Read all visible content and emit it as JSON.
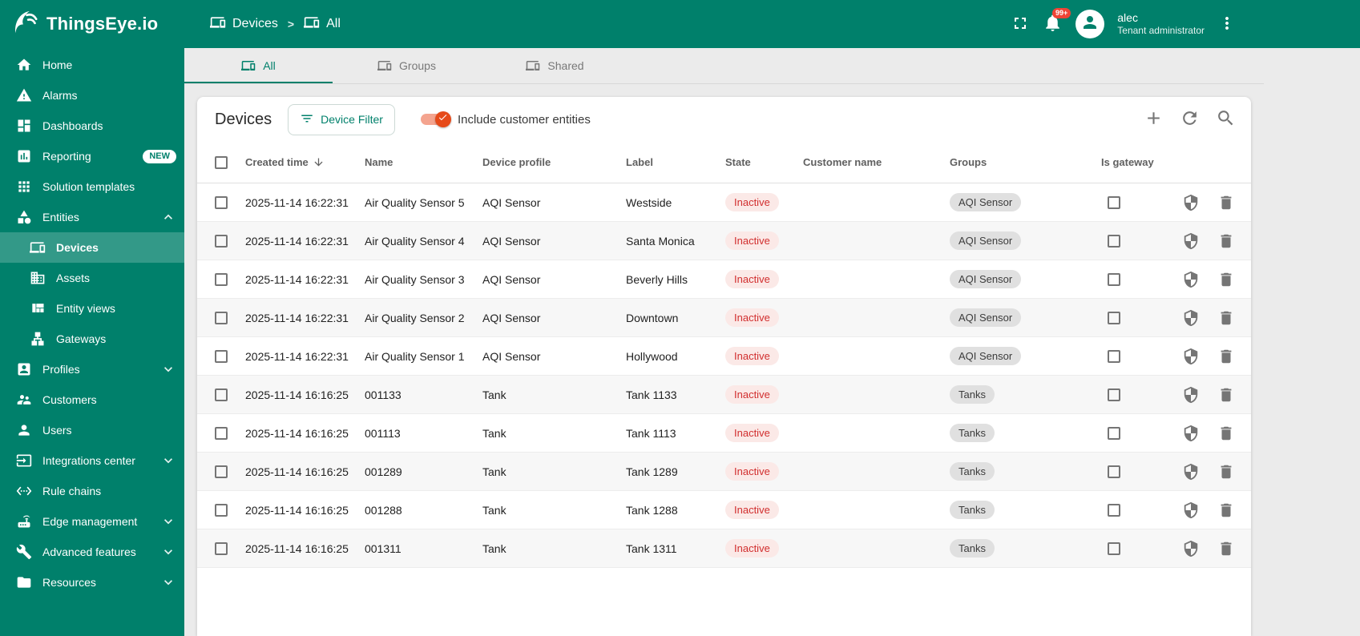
{
  "colors": {
    "brand_teal": "#00806b",
    "toggle_orange": "#e64a19",
    "toggle_track": "#f4a48f",
    "inactive_state_text": "#d12e2e",
    "inactive_state_bg": "#fbe9e7",
    "group_chip_bg": "#e0e0e0",
    "notification_badge_bg": "#ef4436"
  },
  "brand": {
    "name": "ThingsEye.io"
  },
  "header": {
    "breadcrumb": [
      {
        "label": "Devices",
        "icon": "devices-icon"
      },
      {
        "label": "All",
        "icon": "devices-icon"
      }
    ],
    "breadcrumb_separator": ">",
    "notifications_badge": "99+",
    "user": {
      "name": "alec",
      "role": "Tenant administrator"
    }
  },
  "sidebar": {
    "items": [
      {
        "label": "Home",
        "icon": "home-icon"
      },
      {
        "label": "Alarms",
        "icon": "alarms-icon"
      },
      {
        "label": "Dashboards",
        "icon": "dashboards-icon"
      },
      {
        "label": "Reporting",
        "icon": "reporting-icon",
        "badge": "NEW"
      },
      {
        "label": "Solution templates",
        "icon": "solution-templates-icon"
      },
      {
        "label": "Entities",
        "icon": "entities-icon",
        "expanded": true
      },
      {
        "label": "Devices",
        "icon": "devices-icon",
        "sub": true,
        "active": true
      },
      {
        "label": "Assets",
        "icon": "assets-icon",
        "sub": true
      },
      {
        "label": "Entity views",
        "icon": "entity-views-icon",
        "sub": true
      },
      {
        "label": "Gateways",
        "icon": "gateways-icon",
        "sub": true
      },
      {
        "label": "Profiles",
        "icon": "profiles-icon",
        "collapsible": true
      },
      {
        "label": "Customers",
        "icon": "customers-icon"
      },
      {
        "label": "Users",
        "icon": "users-icon"
      },
      {
        "label": "Integrations center",
        "icon": "integrations-icon",
        "collapsible": true
      },
      {
        "label": "Rule chains",
        "icon": "rule-chains-icon"
      },
      {
        "label": "Edge management",
        "icon": "edge-management-icon",
        "collapsible": true
      },
      {
        "label": "Advanced features",
        "icon": "advanced-features-icon",
        "collapsible": true
      },
      {
        "label": "Resources",
        "icon": "resources-icon",
        "collapsible": true
      }
    ]
  },
  "tabs": [
    {
      "label": "All",
      "icon": "devices-icon",
      "active": true
    },
    {
      "label": "Groups",
      "icon": "devices-icon",
      "active": false
    },
    {
      "label": "Shared",
      "icon": "devices-icon",
      "active": false
    }
  ],
  "panel": {
    "title": "Devices",
    "filter_button_label": "Device Filter",
    "toggle_label": "Include customer entities",
    "toggle_checked": true
  },
  "table": {
    "columns": [
      {
        "label": "Created time",
        "sorted": "desc"
      },
      {
        "label": "Name"
      },
      {
        "label": "Device profile"
      },
      {
        "label": "Label"
      },
      {
        "label": "State"
      },
      {
        "label": "Customer name"
      },
      {
        "label": "Groups"
      },
      {
        "label": "Is gateway"
      }
    ],
    "rows": [
      {
        "created_time": "2025-11-14 16:22:31",
        "name": "Air Quality Sensor 5",
        "device_profile": "AQI Sensor",
        "label": "Westside",
        "state": "Inactive",
        "customer_name": "",
        "groups": [
          "AQI Sensor"
        ],
        "is_gateway": false
      },
      {
        "created_time": "2025-11-14 16:22:31",
        "name": "Air Quality Sensor 4",
        "device_profile": "AQI Sensor",
        "label": "Santa Monica",
        "state": "Inactive",
        "customer_name": "",
        "groups": [
          "AQI Sensor"
        ],
        "is_gateway": false
      },
      {
        "created_time": "2025-11-14 16:22:31",
        "name": "Air Quality Sensor 3",
        "device_profile": "AQI Sensor",
        "label": "Beverly Hills",
        "state": "Inactive",
        "customer_name": "",
        "groups": [
          "AQI Sensor"
        ],
        "is_gateway": false
      },
      {
        "created_time": "2025-11-14 16:22:31",
        "name": "Air Quality Sensor 2",
        "device_profile": "AQI Sensor",
        "label": "Downtown",
        "state": "Inactive",
        "customer_name": "",
        "groups": [
          "AQI Sensor"
        ],
        "is_gateway": false
      },
      {
        "created_time": "2025-11-14 16:22:31",
        "name": "Air Quality Sensor 1",
        "device_profile": "AQI Sensor",
        "label": "Hollywood",
        "state": "Inactive",
        "customer_name": "",
        "groups": [
          "AQI Sensor"
        ],
        "is_gateway": false
      },
      {
        "created_time": "2025-11-14 16:16:25",
        "name": "001133",
        "device_profile": "Tank",
        "label": "Tank 1133",
        "state": "Inactive",
        "customer_name": "",
        "groups": [
          "Tanks"
        ],
        "is_gateway": false
      },
      {
        "created_time": "2025-11-14 16:16:25",
        "name": "001113",
        "device_profile": "Tank",
        "label": "Tank 1113",
        "state": "Inactive",
        "customer_name": "",
        "groups": [
          "Tanks"
        ],
        "is_gateway": false
      },
      {
        "created_time": "2025-11-14 16:16:25",
        "name": "001289",
        "device_profile": "Tank",
        "label": "Tank 1289",
        "state": "Inactive",
        "customer_name": "",
        "groups": [
          "Tanks"
        ],
        "is_gateway": false
      },
      {
        "created_time": "2025-11-14 16:16:25",
        "name": "001288",
        "device_profile": "Tank",
        "label": "Tank 1288",
        "state": "Inactive",
        "customer_name": "",
        "groups": [
          "Tanks"
        ],
        "is_gateway": false
      },
      {
        "created_time": "2025-11-14 16:16:25",
        "name": "001311",
        "device_profile": "Tank",
        "label": "Tank 1311",
        "state": "Inactive",
        "customer_name": "",
        "groups": [
          "Tanks"
        ],
        "is_gateway": false
      }
    ]
  }
}
